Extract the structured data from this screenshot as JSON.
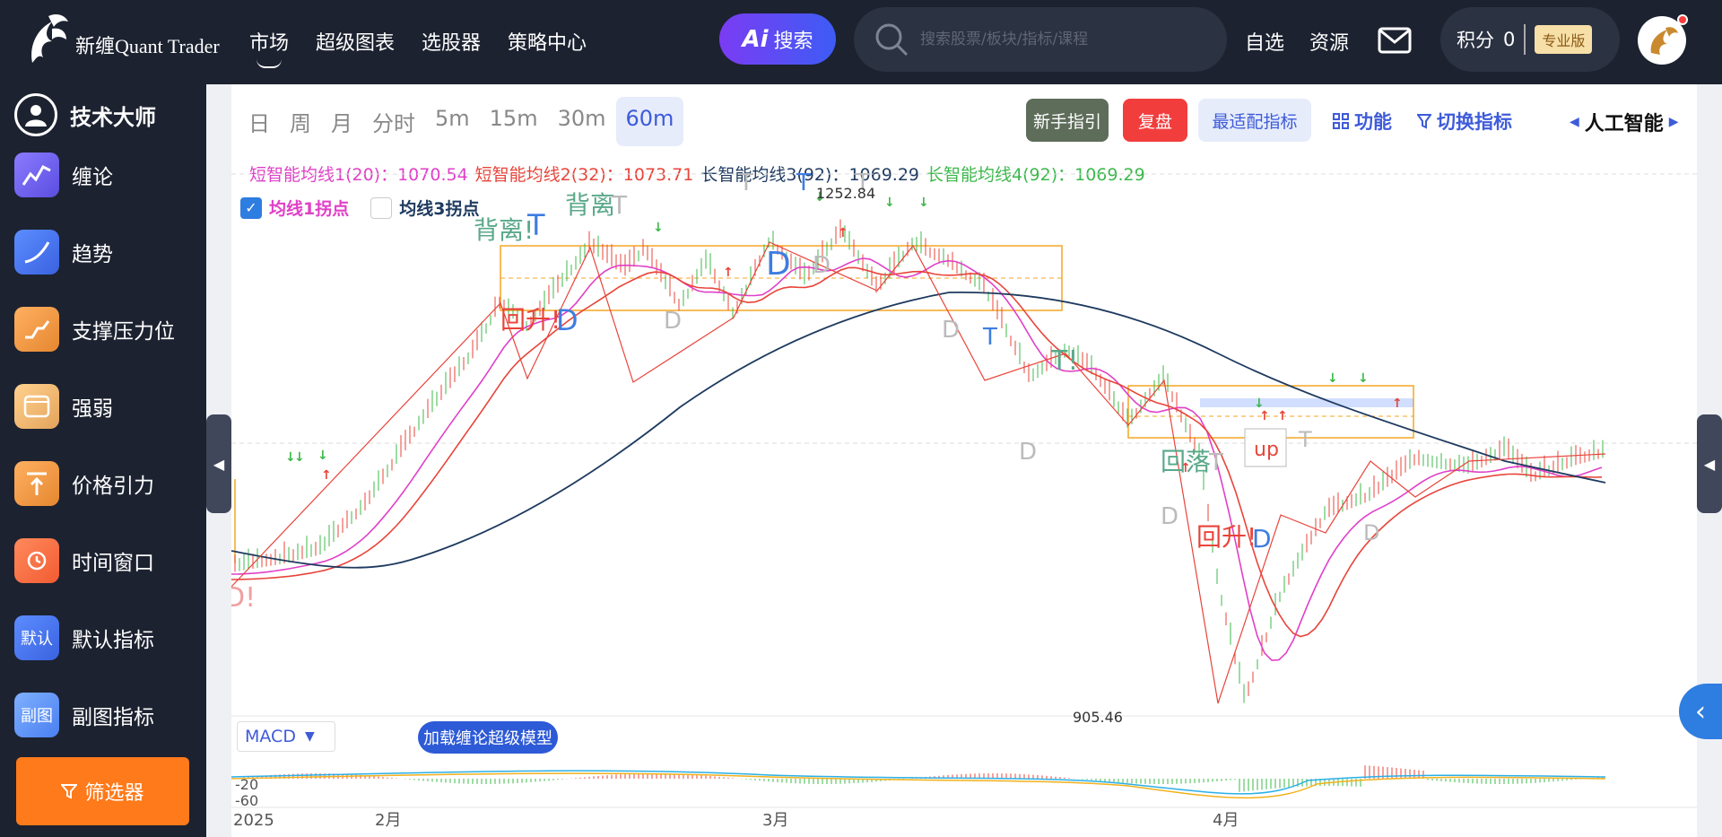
{
  "header": {
    "logo_text": "新缠Quant Trader",
    "nav": [
      {
        "label": "市场",
        "active": true
      },
      {
        "label": "超级图表",
        "active": false
      },
      {
        "label": "选股器",
        "active": false
      },
      {
        "label": "策略中心",
        "active": false
      }
    ],
    "ai_button": {
      "ai": "Ai",
      "label": "搜索"
    },
    "search_placeholder": "搜索股票/板块/指标/课程",
    "links": [
      "自选",
      "资源"
    ],
    "points_label": "积分",
    "points_value": "0",
    "pro_badge": "专业版"
  },
  "sidebar": {
    "title": "技术大师",
    "items": [
      {
        "label": "缠论",
        "icon": "chanlun-icon",
        "color": "purple"
      },
      {
        "label": "趋势",
        "icon": "trend-icon",
        "color": "blue"
      },
      {
        "label": "支撑压力位",
        "icon": "support-resistance-icon",
        "color": "orange"
      },
      {
        "label": "强弱",
        "icon": "strength-icon",
        "color": "gold"
      },
      {
        "label": "价格引力",
        "icon": "price-gravity-icon",
        "color": "orange"
      },
      {
        "label": "时间窗口",
        "icon": "time-window-icon",
        "color": "red"
      },
      {
        "label": "默认指标",
        "icon": "default-indicator-icon",
        "color": "blue",
        "text": "默认"
      },
      {
        "label": "副图指标",
        "icon": "sub-chart-icon",
        "color": "bluelight",
        "text": "副图"
      }
    ],
    "filter_label": "筛选器"
  },
  "toolbar": {
    "periods": [
      "日",
      "周",
      "月",
      "分时",
      "5m",
      "15m",
      "30m",
      "60m"
    ],
    "active_period": "60m",
    "guide": "新手指引",
    "replay": "复盘",
    "best_fit": "最适配指标",
    "function": "功能",
    "switch_indicator": "切换指标",
    "ai_label": "人工智能"
  },
  "legend": [
    {
      "label": "短智能均线1(20)：",
      "value": "1070.54",
      "color": "#e040c8"
    },
    {
      "label": "短智能均线2(32)：",
      "value": "1073.71",
      "color": "#e8443a"
    },
    {
      "label": "长智能均线3(92)：",
      "value": "1069.29",
      "color": "#1e3a5f"
    },
    {
      "label": "长智能均线4(92)：",
      "value": "1069.29",
      "color": "#3cb84a"
    }
  ],
  "checks": [
    {
      "label": "均线1拐点",
      "checked": true,
      "color": "#e040c8"
    },
    {
      "label": "均线3拐点",
      "checked": false,
      "color": "#1e3a5f"
    }
  ],
  "annotations": {
    "high_label": "1252.84",
    "low_label": "905.46",
    "beili1": "背离!",
    "beili2": "背离",
    "huisheng1": "回升!",
    "huisheng2": "回升!",
    "huiluo": "回落",
    "up": "up",
    "t": "T",
    "t_bang": "T!",
    "d": "D",
    "d_bang": "D!"
  },
  "macd": {
    "select_label": "MACD",
    "load_button": "加载缠论超级模型",
    "y_labels": [
      "-20",
      "-60"
    ]
  },
  "x_axis": [
    "2025",
    "2月",
    "3月",
    "4月"
  ],
  "colors": {
    "up": "#e8443a",
    "down": "#3cb84a",
    "ma20": "#e040c8",
    "ma32": "#e8443a",
    "ma92": "#1e3a5f",
    "box": "#f5a623",
    "accent": "#3e5bd9"
  }
}
